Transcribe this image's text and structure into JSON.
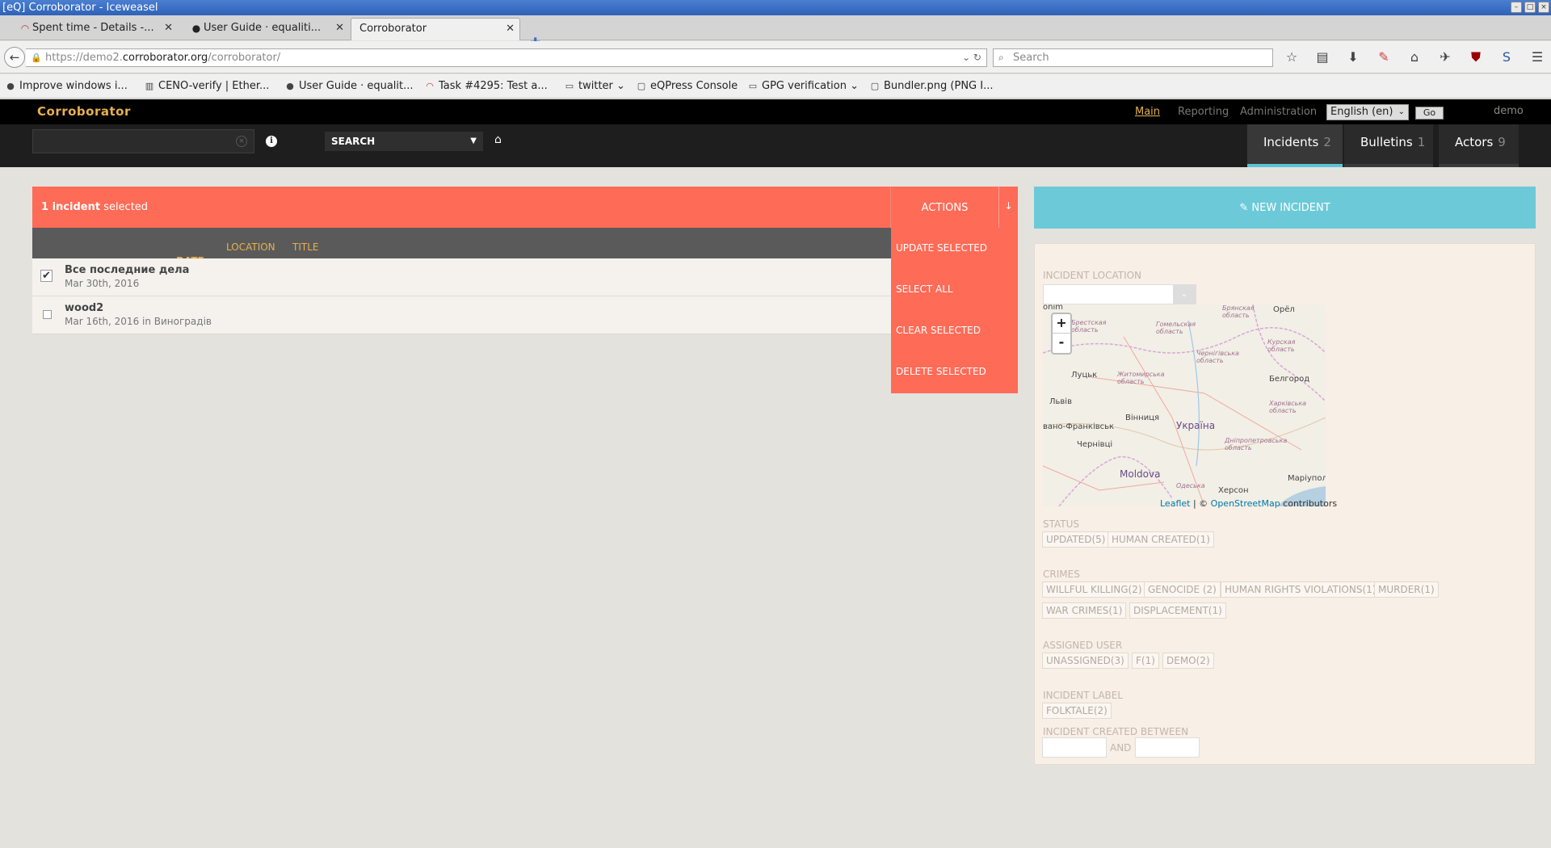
{
  "window": {
    "title": "[eQ] Corroborator - Iceweasel"
  },
  "tabs": [
    {
      "label": "Spent time - Details -...",
      "icon": "redmine-icon"
    },
    {
      "label": "User Guide · equaliti...",
      "icon": "github-icon"
    },
    {
      "label": "Corroborator",
      "icon": "none"
    }
  ],
  "url": {
    "prefix": "https://demo2.",
    "domain": "corroborator.org",
    "path": "/corroborator/"
  },
  "browser_search": {
    "placeholder": "Search"
  },
  "bookmarks": [
    {
      "label": "Improve windows i...",
      "icon": "github-icon"
    },
    {
      "label": "CENO-verify | Ether...",
      "icon": "etherpad-icon"
    },
    {
      "label": "User Guide · equalit...",
      "icon": "github-icon"
    },
    {
      "label": "Task #4295: Test a...",
      "icon": "redmine-icon"
    },
    {
      "label": "twitter",
      "icon": "folder-icon"
    },
    {
      "label": "eQPress Console",
      "icon": "page-icon"
    },
    {
      "label": "GPG verification",
      "icon": "folder-icon"
    },
    {
      "label": "Bundler.png (PNG I...",
      "icon": "page-icon"
    }
  ],
  "app": {
    "brand": "Corroborator",
    "nav": {
      "main": "Main",
      "reporting": "Reporting",
      "administration": "Administration"
    },
    "language": "English (en)",
    "go": "Go",
    "user": "demo",
    "search_type": "SEARCH",
    "main_tabs": [
      {
        "label": "Incidents",
        "count": "2",
        "active": true
      },
      {
        "label": "Bulletins",
        "count": "1",
        "active": false
      },
      {
        "label": "Actors",
        "count": "9",
        "active": false
      }
    ]
  },
  "selection": {
    "count_text": "1 incident",
    "suffix": " selected"
  },
  "actions": {
    "label": "ACTIONS",
    "items": [
      "UPDATE SELECTED",
      "SELECT ALL",
      "CLEAR SELECTED",
      "DELETE SELECTED"
    ]
  },
  "columns": {
    "date": "DATE",
    "location": "LOCATION",
    "title": "TITLE"
  },
  "incidents": [
    {
      "title": "Все последние дела",
      "subtitle": "Mar 30th, 2016",
      "checked": true
    },
    {
      "title": "wood2",
      "subtitle": "Mar 16th, 2016 in Виноградів",
      "checked": false
    }
  ],
  "new_incident": "NEW INCIDENT",
  "filters": {
    "location_label": "INCIDENT LOCATION",
    "status_label": "STATUS",
    "status_tags": [
      "UPDATED(5)",
      "HUMAN CREATED(1)"
    ],
    "crimes_label": "CRIMES",
    "crimes_tags": [
      "WILLFUL KILLING(2)",
      "GENOCIDE (2)",
      "HUMAN RIGHTS VIOLATIONS(1)",
      "MURDER(1)",
      "WAR CRIMES(1)",
      "DISPLACEMENT(1)"
    ],
    "assigned_label": "ASSIGNED USER",
    "assigned_tags": [
      "UNASSIGNED(3)",
      "F(1)",
      "DEMO(2)"
    ],
    "label_label": "INCIDENT LABEL",
    "label_tags": [
      "FOLKTALE(2)"
    ],
    "created_label": "INCIDENT CREATED BETWEEN",
    "and": "AND"
  },
  "map": {
    "zoom_in": "+",
    "zoom_out": "-",
    "attribution_leaflet": "Leaflet",
    "attribution_sep": " | © ",
    "attribution_osm": "OpenStreetMap",
    "attribution_tail": " contributors",
    "labels": {
      "orel": "Орёл",
      "bryansk": "Брянская область",
      "brest": "Брестская область",
      "gomel": "Гомельская область",
      "kursk": "Курская область",
      "chernigiv": "Чернігівська область",
      "lutsk": "Луцьк",
      "zhytomyr": "Житомирська область",
      "belgorod": "Белгород",
      "lviv": "Львів",
      "kharkiv": "Харківська область",
      "vinnytsia": "Вінниця",
      "ukraine": "Україна",
      "frankivsk": "вано-Франківськ",
      "dnipro": "Дніпропетровська область",
      "chernivtsi": "Чернівці",
      "moldova": "Moldova",
      "odesa": "Одеська",
      "kherson": "Херсон",
      "mariupol": "Маріуполь",
      "slonim": "onim"
    }
  },
  "colors": {
    "brand": "#e7b04f",
    "coral": "#fe6b57",
    "teal": "#6ccad8",
    "panel": "#f8efe6"
  }
}
